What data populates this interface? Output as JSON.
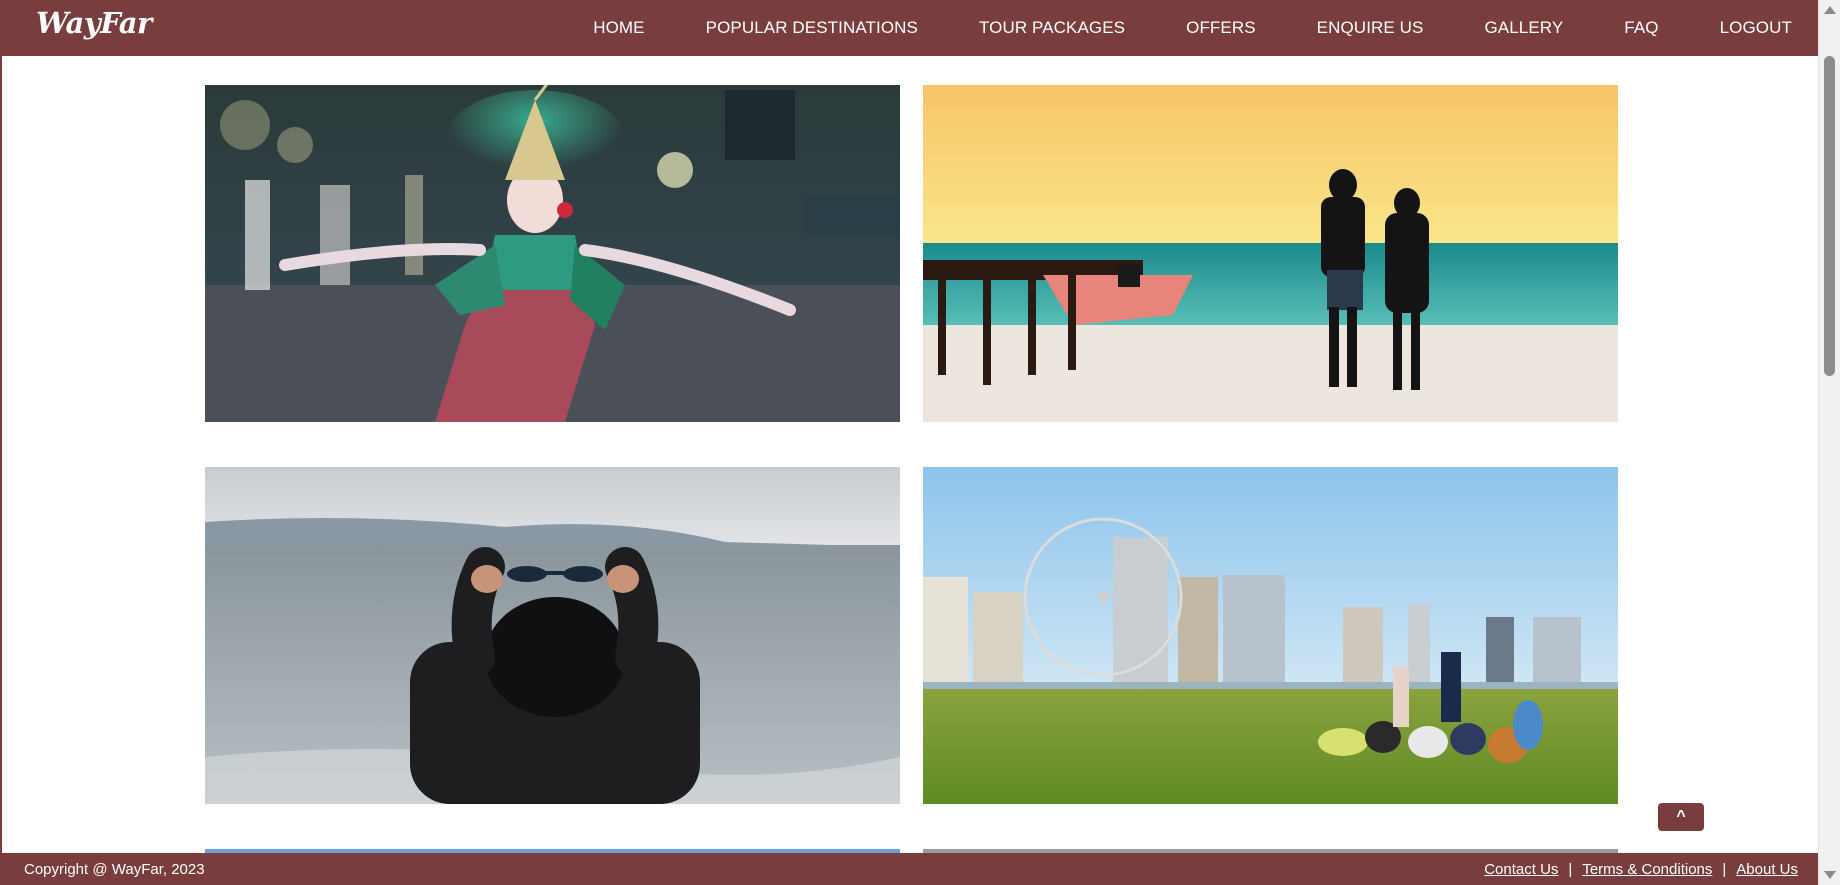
{
  "brand": {
    "name": "WayFar"
  },
  "nav": {
    "items": [
      {
        "label": "HOME"
      },
      {
        "label": "POPULAR DESTINATIONS"
      },
      {
        "label": "TOUR PACKAGES"
      },
      {
        "label": "OFFERS"
      },
      {
        "label": "ENQUIRE US"
      },
      {
        "label": "GALLERY"
      },
      {
        "label": "FAQ"
      },
      {
        "label": "LOGOUT"
      }
    ]
  },
  "back_to_top": {
    "label": "^"
  },
  "footer": {
    "copyright": "Copyright @ WayFar, 2023",
    "links": [
      {
        "label": "Contact Us"
      },
      {
        "label": "Terms & Conditions"
      },
      {
        "label": "About Us"
      }
    ],
    "separator": "|"
  },
  "colors": {
    "primary": "#7a3d3d",
    "text_on_primary": "#ffffff"
  }
}
